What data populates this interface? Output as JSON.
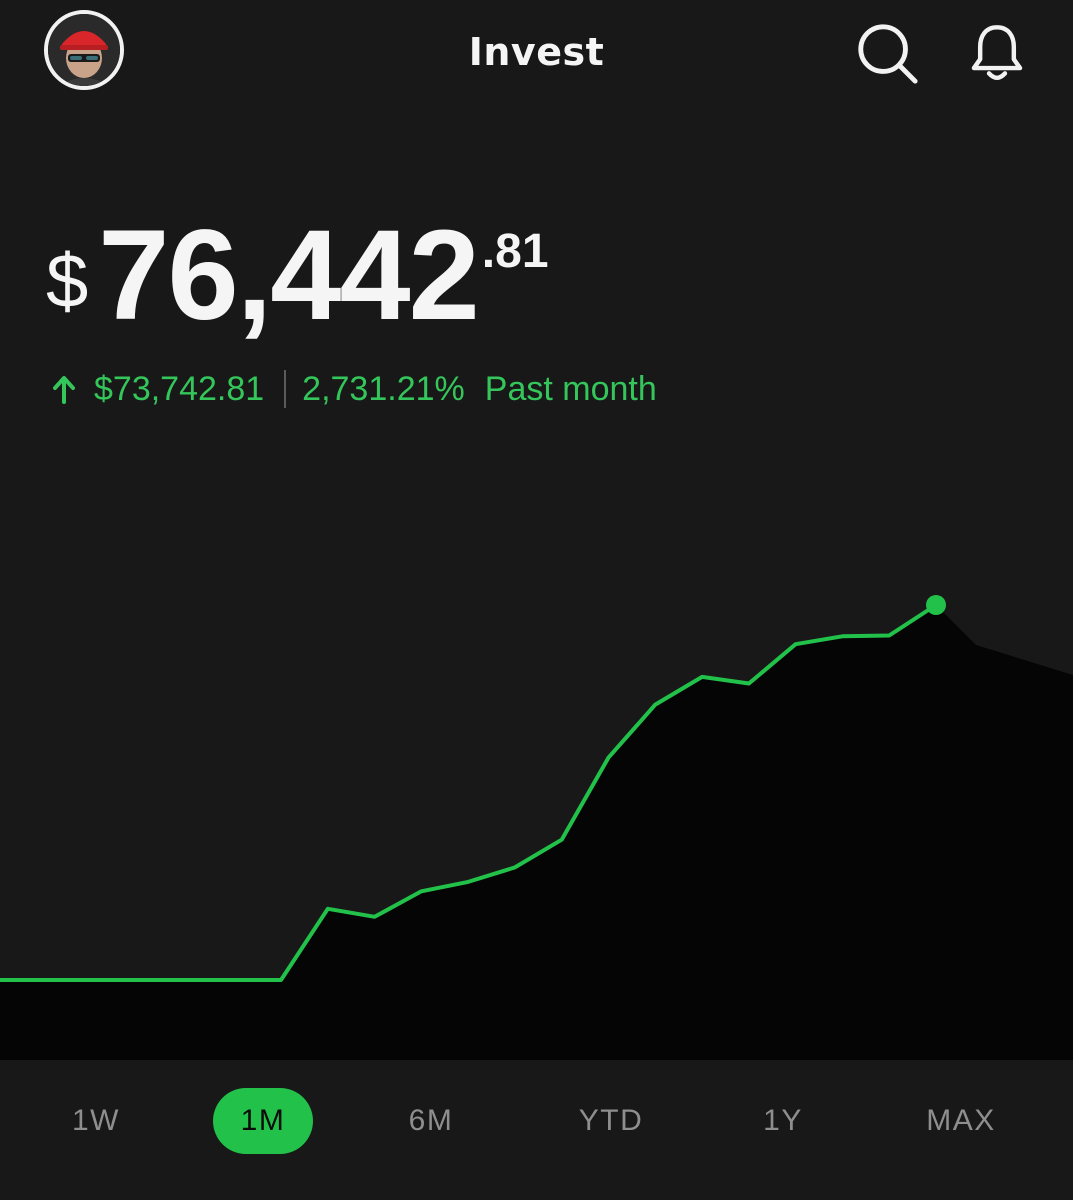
{
  "header": {
    "title": "Invest",
    "icons": {
      "search": "search-icon",
      "notifications": "bell-icon"
    }
  },
  "portfolio": {
    "currency_symbol": "$",
    "value_whole": "76,442",
    "value_cents": ".81",
    "change_amount": "$73,742.81",
    "change_percent": "2,731.21%",
    "period_label": "Past month",
    "direction_icon": "arrow-up-icon"
  },
  "colors": {
    "accent": "#22c24a",
    "gain_text": "#34c65a",
    "background": "#181818",
    "chart_fill": "#050505"
  },
  "chart_data": {
    "type": "line",
    "x": [
      0,
      1,
      2,
      3,
      4,
      5,
      6,
      7,
      8,
      9,
      10,
      11,
      12,
      13,
      14,
      15,
      16,
      17,
      18,
      19
    ],
    "values": [
      2700,
      2700,
      2700,
      2700,
      2700,
      2700,
      2700,
      12500,
      11400,
      14900,
      16200,
      18200,
      22000,
      33300,
      40600,
      44400,
      43500,
      48900,
      50000,
      50100,
      54300
    ],
    "grid": false,
    "legend": "none",
    "end_marker": true
  },
  "range_tabs": [
    {
      "label": "1W",
      "active": false
    },
    {
      "label": "1M",
      "active": true
    },
    {
      "label": "6M",
      "active": false
    },
    {
      "label": "YTD",
      "active": false
    },
    {
      "label": "1Y",
      "active": false
    },
    {
      "label": "MAX",
      "active": false
    }
  ]
}
